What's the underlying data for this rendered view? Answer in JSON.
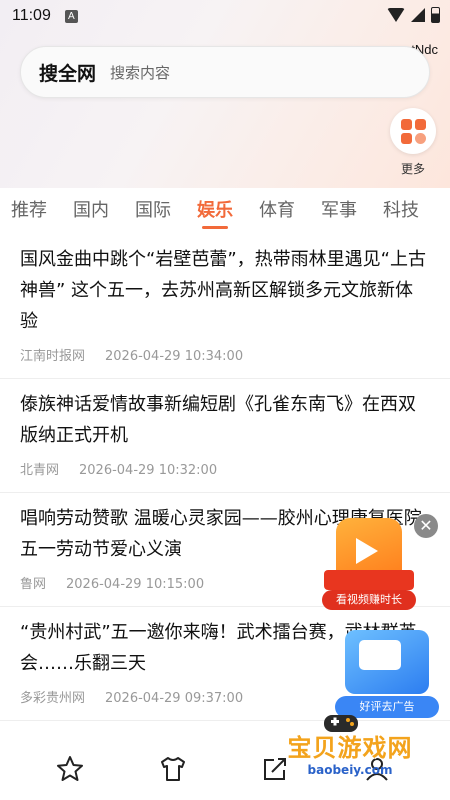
{
  "status_bar": {
    "time": "11:09",
    "notification_icon": "A",
    "icons": [
      "wifi-icon",
      "signal-icon",
      "battery-icon"
    ]
  },
  "user_tag": "tNdc",
  "search": {
    "brand": "搜全网",
    "placeholder": "搜索内容"
  },
  "more_button": {
    "label": "更多",
    "icon": "grid-icon"
  },
  "tabs": [
    {
      "label": "推荐",
      "active": false
    },
    {
      "label": "国内",
      "active": false
    },
    {
      "label": "国际",
      "active": false
    },
    {
      "label": "娱乐",
      "active": true
    },
    {
      "label": "体育",
      "active": false
    },
    {
      "label": "军事",
      "active": false
    },
    {
      "label": "科技",
      "active": false
    }
  ],
  "news": [
    {
      "title": "国风金曲中跳个“岩壁芭蕾”，热带雨林里遇见“上古神兽” 这个五一，去苏州高新区解锁多元文旅新体验",
      "source": "江南时报网",
      "time": "2026-04-29 10:34:00"
    },
    {
      "title": "傣族神话爱情故事新编短剧《孔雀东南飞》在西双版纳正式开机",
      "source": "北青网",
      "time": "2026-04-29 10:32:00"
    },
    {
      "title": "唱响劳动赞歌 温暖心灵家园——胶州心理康复医院五一劳动节爱心义演",
      "source": "鲁网",
      "time": "2026-04-29 10:15:00"
    },
    {
      "title": "“贵州村武”五一邀你来嗨！武术擂台赛，武林群英会……乐翻三天",
      "source": "多彩贵州网",
      "time": "2026-04-29 09:37:00"
    }
  ],
  "float_ad": {
    "label": "看视频赚时长",
    "close": "✕"
  },
  "review_ad": {
    "label": "好评去广告"
  },
  "bottom_bar": {
    "icons": [
      "star-icon",
      "shirt-icon",
      "share-icon",
      "user-icon"
    ]
  },
  "watermark": {
    "text": "宝贝游戏网",
    "url": "baobeiy.com"
  },
  "colors": {
    "accent": "#f26a3a",
    "meta_text": "#999999"
  }
}
